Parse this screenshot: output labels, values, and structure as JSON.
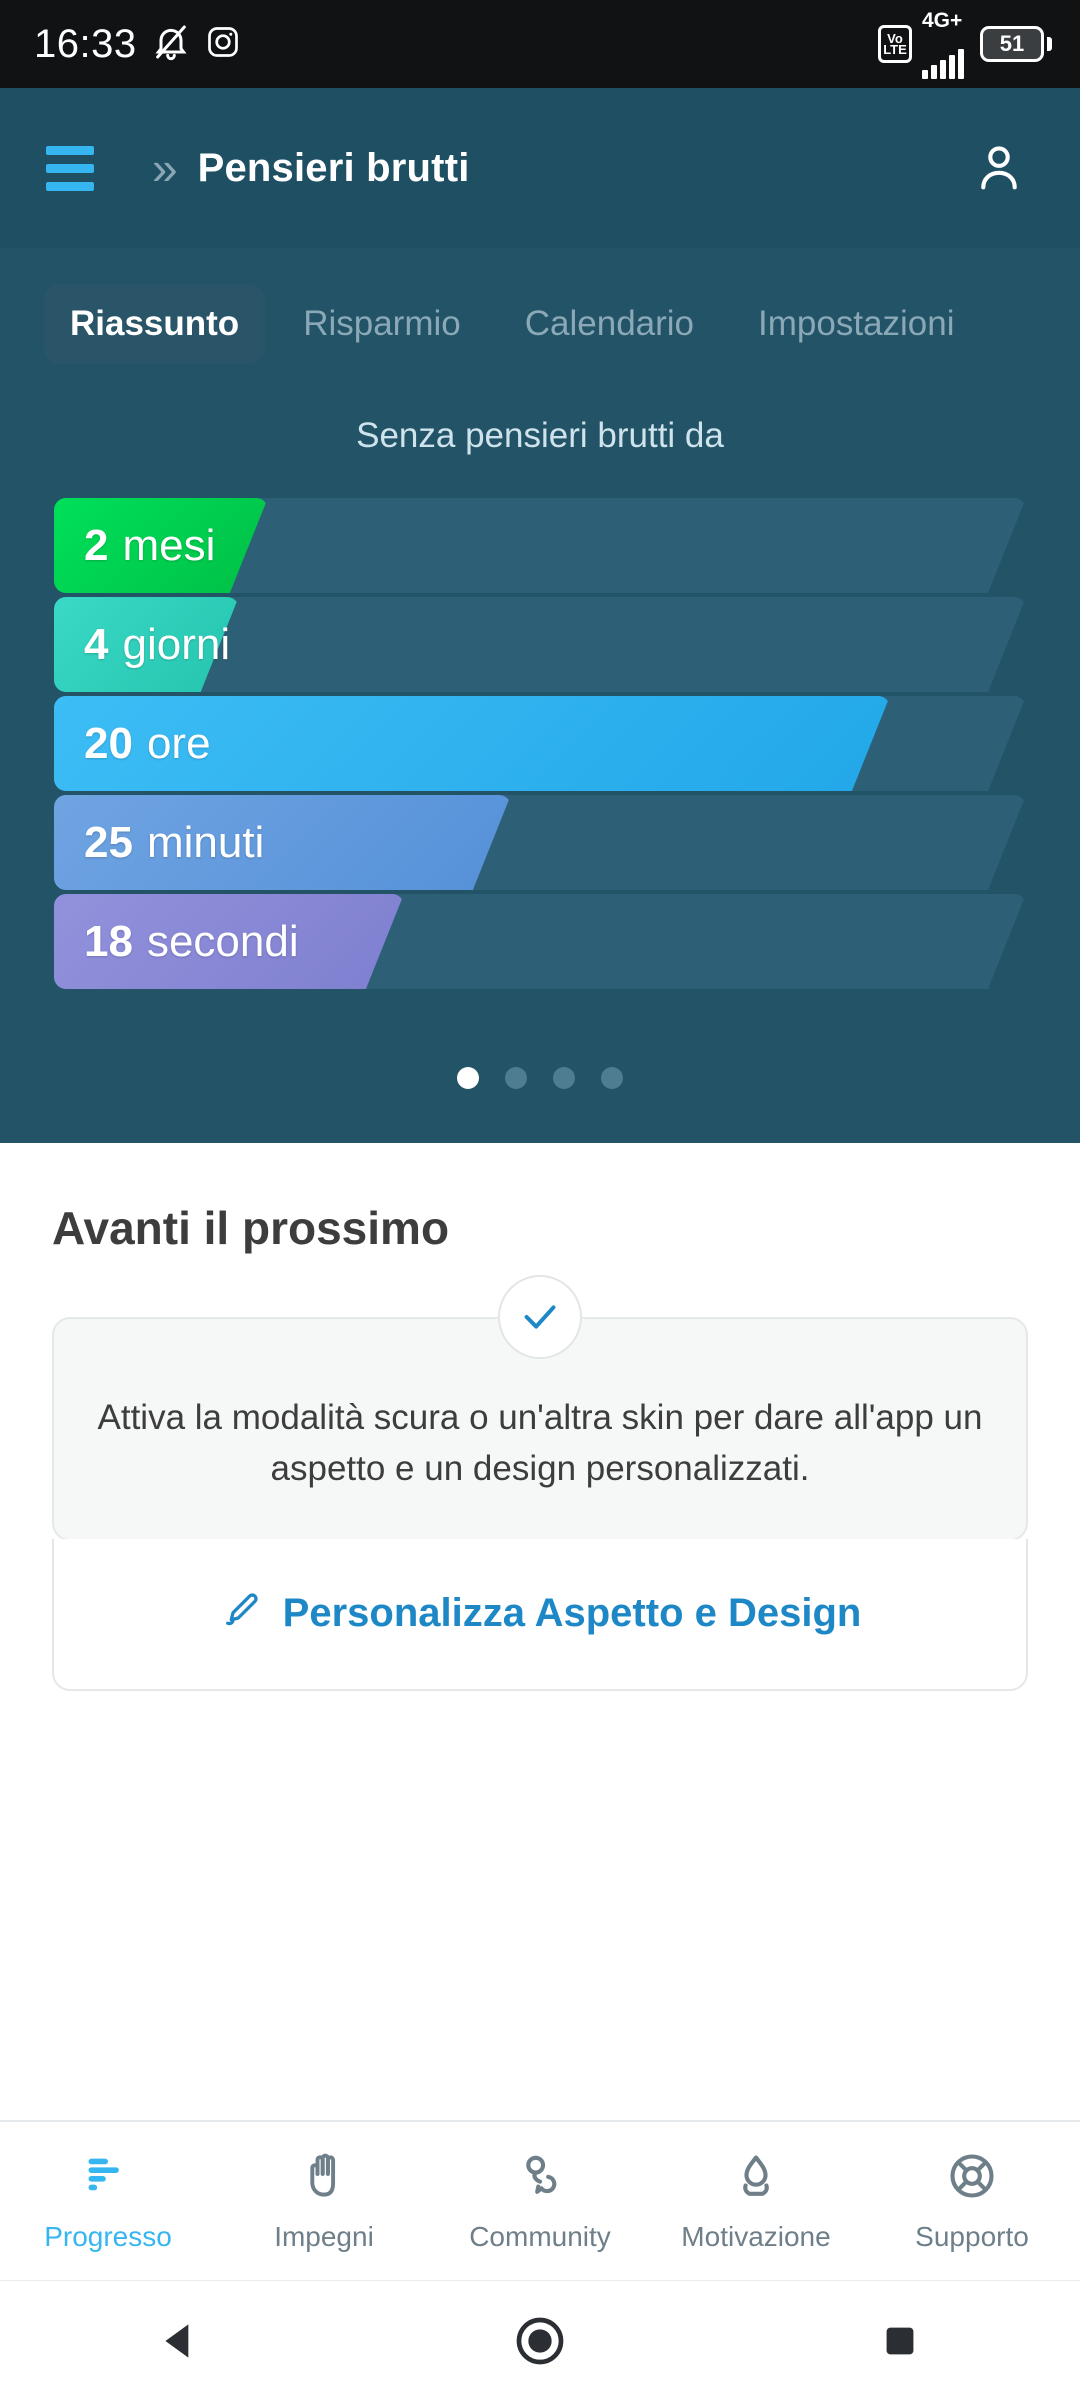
{
  "statusbar": {
    "time": "16:33",
    "icons": [
      "bell-muted-icon",
      "instagram-icon"
    ],
    "volte": {
      "line1": "Vo",
      "line2": "LTE"
    },
    "network": "4G+",
    "battery_level": "51"
  },
  "appbar": {
    "menu_icon": "hamburger-icon",
    "chevron_icon": "chevron-double-right-icon",
    "title": "Pensieri brutti",
    "profile_icon": "person-icon"
  },
  "tabs": [
    {
      "label": "Riassunto",
      "active": true
    },
    {
      "label": "Risparmio",
      "active": false
    },
    {
      "label": "Calendario",
      "active": false
    },
    {
      "label": "Impostazioni",
      "active": false
    }
  ],
  "summary": {
    "subtitle": "Senza pensieri brutti da",
    "bars": [
      {
        "value": "2",
        "unit": "mesi",
        "fill_percent": 22,
        "color_from": "#00e05a",
        "color_to": "#00bf46"
      },
      {
        "value": "4",
        "unit": "giorni",
        "fill_percent": 19,
        "color_from": "#3ad9c6",
        "color_to": "#24c4ae"
      },
      {
        "value": "20",
        "unit": "ore",
        "fill_percent": 86,
        "color_from": "#3dbdf5",
        "color_to": "#22a7e8"
      },
      {
        "value": "25",
        "unit": "minuti",
        "fill_percent": 47,
        "color_from": "#6fa4e2",
        "color_to": "#5590d8"
      },
      {
        "value": "18",
        "unit": "secondi",
        "fill_percent": 36,
        "color_from": "#9191dc",
        "color_to": "#7f7fd0"
      }
    ],
    "pager": {
      "count": 4,
      "active_index": 0
    }
  },
  "next_up": {
    "title": "Avanti il prossimo",
    "badge_icon": "check-icon",
    "tip_text": "Attiva la modalità scura o un'altra skin per dare all'app un aspetto e un design personalizzati.",
    "action_icon": "brush-icon",
    "action_label": "Personalizza Aspetto e Design"
  },
  "bottom_nav": [
    {
      "label": "Progresso",
      "icon": "bar-chart-icon",
      "active": true
    },
    {
      "label": "Impegni",
      "icon": "hand-icon",
      "active": false
    },
    {
      "label": "Community",
      "icon": "people-chat-icon",
      "active": false
    },
    {
      "label": "Motivazione",
      "icon": "flame-icon",
      "active": false
    },
    {
      "label": "Supporto",
      "icon": "life-ring-icon",
      "active": false
    }
  ],
  "android_nav": [
    {
      "icon": "back-triangle-icon"
    },
    {
      "icon": "home-circle-icon"
    },
    {
      "icon": "recents-square-icon"
    }
  ],
  "colors": {
    "panel_bg": "#235367",
    "appbar_bg": "#1f4f62",
    "accent": "#36b6f0",
    "link": "#1e88c7",
    "track": "#2d6076"
  }
}
